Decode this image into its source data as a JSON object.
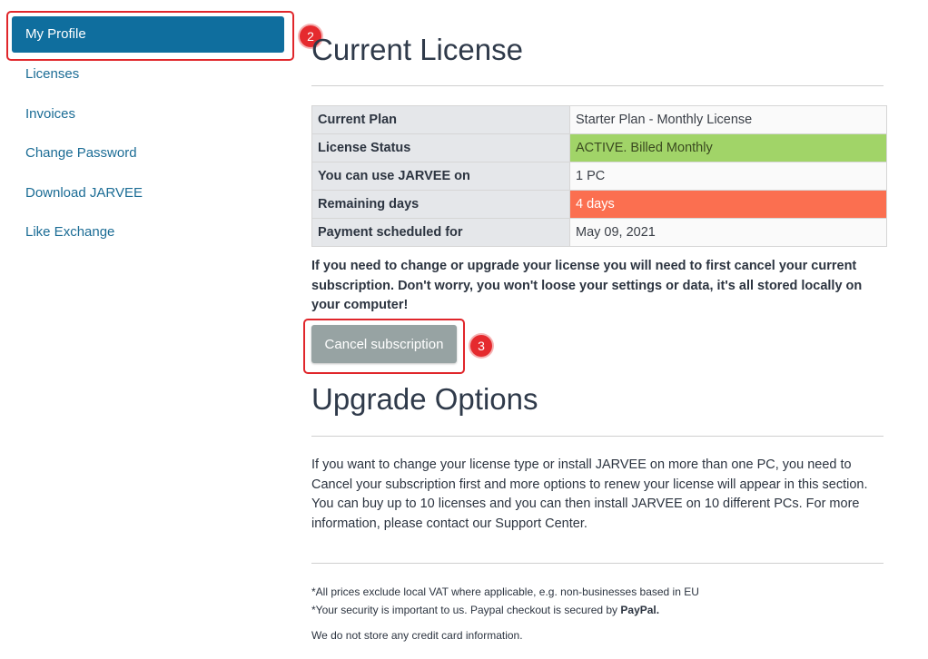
{
  "sidebar": {
    "items": [
      {
        "label": "My Profile",
        "active": true
      },
      {
        "label": "Licenses"
      },
      {
        "label": "Invoices"
      },
      {
        "label": "Change Password"
      },
      {
        "label": "Download JARVEE"
      },
      {
        "label": "Like Exchange"
      }
    ]
  },
  "annotations": {
    "badge_2": "2",
    "badge_3": "3"
  },
  "current_license": {
    "title": "Current License",
    "rows": [
      {
        "key": "Current Plan",
        "value": "Starter Plan - Monthly License"
      },
      {
        "key": "License Status",
        "value": "ACTIVE. Billed Monthly",
        "status_color": "#a1d468"
      },
      {
        "key": "You can use JARVEE on",
        "value": "1 PC"
      },
      {
        "key": "Remaining days",
        "value": "4 days",
        "status_color": "#fb6f50"
      },
      {
        "key": "Payment scheduled for",
        "value": "May 09, 2021"
      }
    ],
    "warning": "If you need to change or upgrade your license you will need to first cancel your current subscription. Don't worry, you won't loose your settings or data, it's all stored locally on your computer!",
    "cancel_label": "Cancel subscription"
  },
  "upgrade": {
    "title": "Upgrade Options",
    "paragraph": "If you want to change your license type or install JARVEE on more than one PC, you need to Cancel your subscription first and more options to renew your license will appear in this section. You can buy up to 10 licenses and you can then install JARVEE on 10 different PCs. For more information, please contact our Support Center."
  },
  "footer": {
    "vat_note": "*All prices exclude local VAT where applicable, e.g. non-businesses based in EU",
    "security_note": "*Your security is important to us. Paypal checkout is secured by",
    "paypal": "PayPal.",
    "card_note": "We do not store any credit card information."
  },
  "colors": {
    "accent": "#0f6e9e",
    "link": "#1b6c95",
    "highlight": "#e0262b"
  }
}
